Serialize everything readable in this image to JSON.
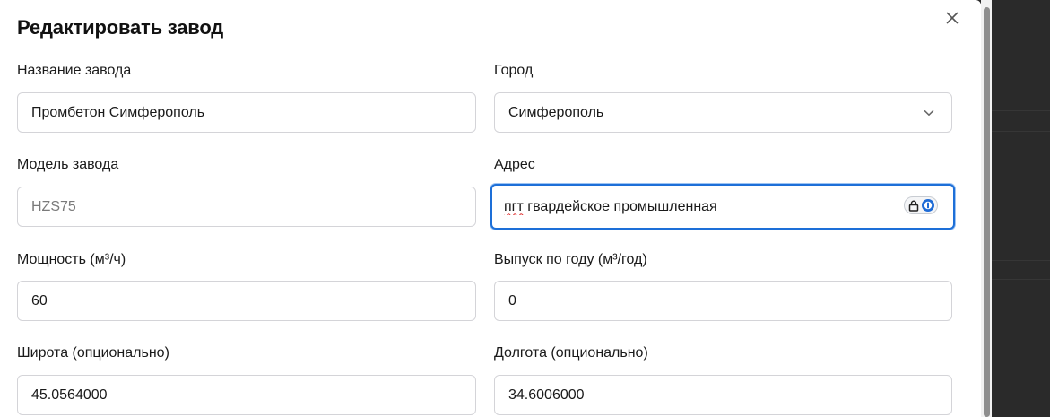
{
  "dialog": {
    "title": "Редактировать завод"
  },
  "fields": {
    "plant_name": {
      "label": "Название завода",
      "value": "Промбетон Симферополь"
    },
    "city": {
      "label": "Город",
      "value": "Симферополь"
    },
    "plant_model": {
      "label": "Модель завода",
      "value": "HZS75"
    },
    "address": {
      "label": "Адрес",
      "value_misspelled": "пгт",
      "value_rest": " гвардейское промышленная"
    },
    "capacity": {
      "label": "Мощность (м³/ч)",
      "value": "60"
    },
    "annual_output": {
      "label": "Выпуск по году (м³/год)",
      "value": "0"
    },
    "latitude": {
      "label": "Широта (опционально)",
      "value": "45.0564000"
    },
    "longitude": {
      "label": "Долгота (опционально)",
      "value": "34.6006000"
    }
  },
  "icons": {
    "close": "close-icon",
    "dropdown": "chevron-down-icon",
    "password_manager": "lock-icon"
  },
  "colors": {
    "focus_border": "#1d6fd8",
    "field_border": "#d4d4d8",
    "backdrop": "#2b2b2b"
  }
}
